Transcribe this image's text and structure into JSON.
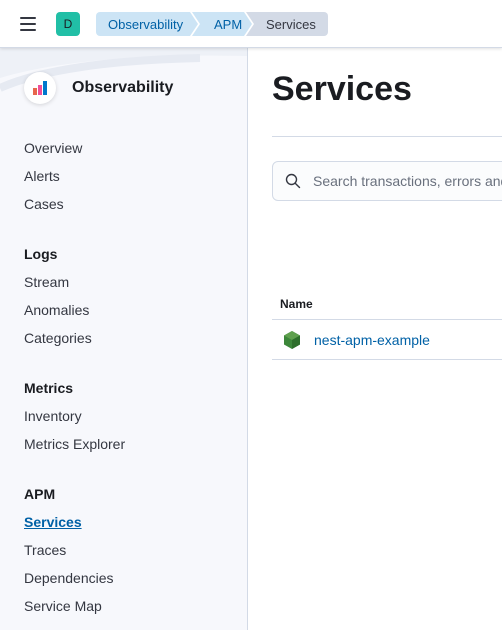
{
  "header": {
    "space_initial": "D",
    "breadcrumbs": [
      "Observability",
      "APM",
      "Services"
    ]
  },
  "sidebar": {
    "title": "Observability",
    "groups": [
      {
        "title": "",
        "items": [
          "Overview",
          "Alerts",
          "Cases"
        ]
      },
      {
        "title": "Logs",
        "items": [
          "Stream",
          "Anomalies",
          "Categories"
        ]
      },
      {
        "title": "Metrics",
        "items": [
          "Inventory",
          "Metrics Explorer"
        ]
      },
      {
        "title": "APM",
        "items": [
          "Services",
          "Traces",
          "Dependencies",
          "Service Map"
        ]
      }
    ],
    "active_item": "Services"
  },
  "main": {
    "title": "Services",
    "search": {
      "placeholder": "Search transactions, errors and metrics"
    },
    "table": {
      "columns": [
        "Name"
      ],
      "rows": [
        {
          "name": "nest-apm-example",
          "agent_icon": "nodejs-hexagon-icon"
        }
      ]
    }
  },
  "colors": {
    "accent": "#0061a6",
    "space_avatar": "#21bfa6",
    "breadcrumb_bg": "#cce4f5",
    "breadcrumb_current_bg": "#d3dae6",
    "nodejs_green": "#3c873a"
  }
}
